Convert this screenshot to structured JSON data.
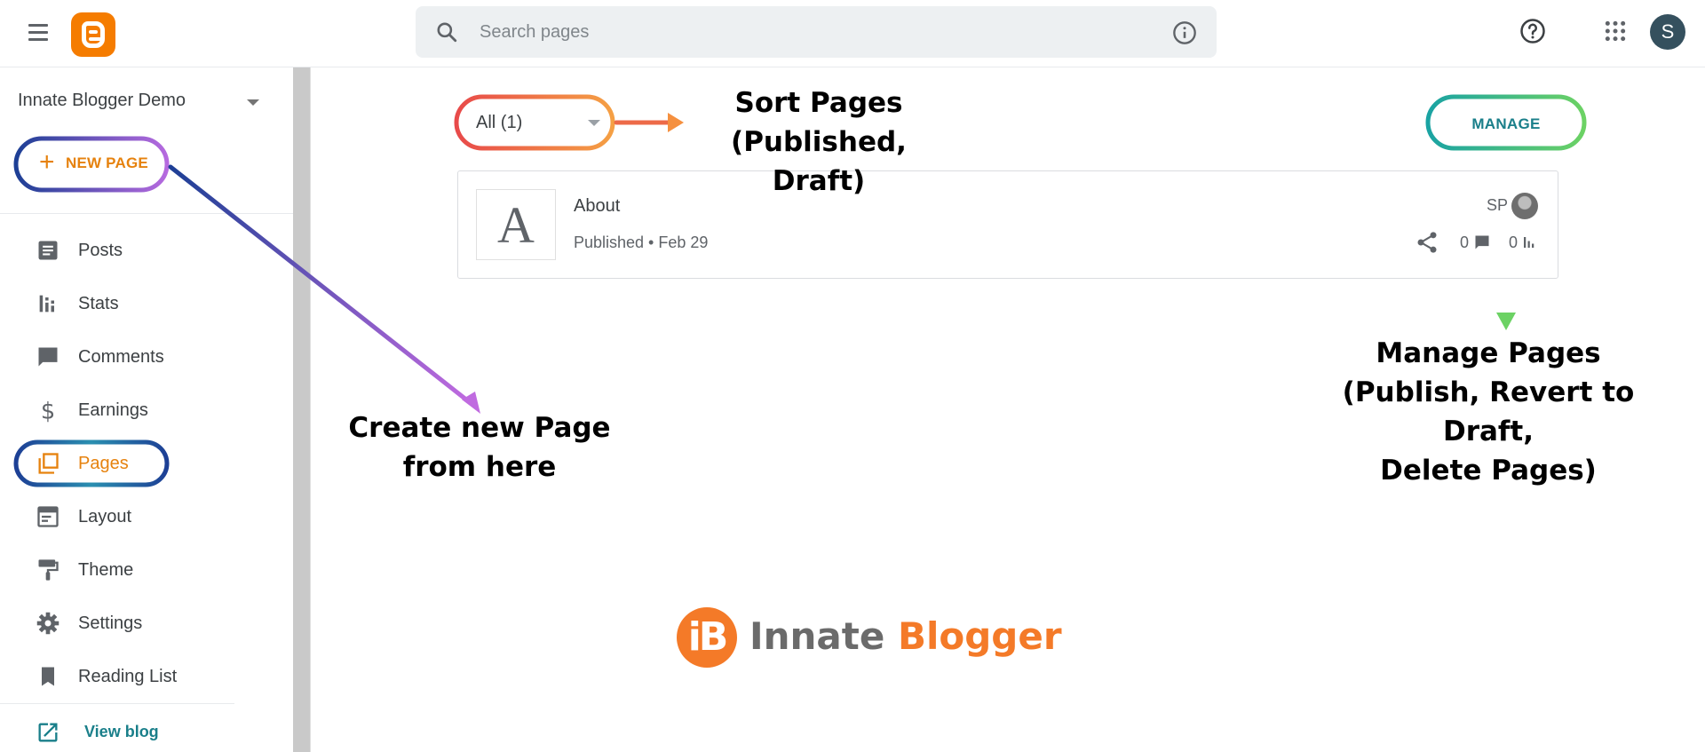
{
  "header": {
    "search_placeholder": "Search pages",
    "avatar_initial": "S"
  },
  "sidebar": {
    "blog_name": "Innate Blogger Demo",
    "new_page_label": "NEW PAGE",
    "items": [
      {
        "label": "Posts",
        "icon": "posts-icon"
      },
      {
        "label": "Stats",
        "icon": "stats-icon"
      },
      {
        "label": "Comments",
        "icon": "comment-icon"
      },
      {
        "label": "Earnings",
        "icon": "dollar-icon"
      },
      {
        "label": "Pages",
        "icon": "pages-icon",
        "active": true
      },
      {
        "label": "Layout",
        "icon": "layout-icon"
      },
      {
        "label": "Theme",
        "icon": "paint-roller-icon"
      },
      {
        "label": "Settings",
        "icon": "gear-icon"
      },
      {
        "label": "Reading List",
        "icon": "bookmark-icon"
      }
    ],
    "view_blog_label": "View blog"
  },
  "main": {
    "filter_label": "All (1)",
    "manage_label": "MANAGE",
    "pages": [
      {
        "thumb_letter": "A",
        "title": "About",
        "status": "Published",
        "date": "Feb 29",
        "meta": "Published • Feb 29",
        "author": "SP",
        "comments": "0",
        "views": "0"
      }
    ]
  },
  "annotations": {
    "sort_line1": "Sort Pages",
    "sort_line2": "(Published, Draft)",
    "create_line1": "Create new Page",
    "create_line2": "from here",
    "manage_line1": "Manage Pages",
    "manage_line2": "(Publish, Revert to Draft,",
    "manage_line3": "Delete Pages)"
  },
  "watermark": {
    "mark": "iB",
    "word1": "Innate",
    "word2": "Blogger"
  },
  "colors": {
    "accent_orange": "#e6820e",
    "teal": "#1a7f8a",
    "blogger_orange": "#f57c00"
  }
}
